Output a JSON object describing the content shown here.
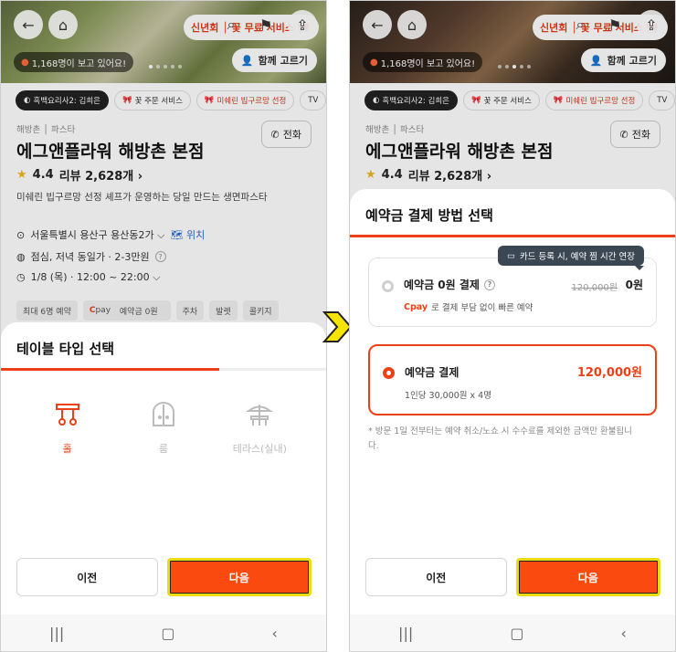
{
  "screen1": {
    "hero": {
      "promo": "신년회 │ 꽃 무료 서비스 🎀",
      "views": "1,168명이 보고 있어요!",
      "together": "함께 고르기"
    },
    "tags": [
      "흑백요리사2: 김희은",
      "꽃 주문 서비스",
      "미쉐린 빕구르망 선정",
      "TV"
    ],
    "category": "해방촌 │ 파스타",
    "call": "전화",
    "name": "에그앤플라워 해방촌 본점",
    "rating": "4.4",
    "reviews": "리뷰 2,628개 ›",
    "description": "미쉐린 빕구르망 선정 셰프가 운영하는 당일 만드는 생면파스타",
    "address": "서울특별시 용산구 용산동2가 ⌵",
    "map": "위치",
    "hours": "점심, 저녁 동일가 · 2-3만원",
    "date": "1/8 (목) · 12:00 ~ 22:00 ⌵",
    "amenities": [
      "최대 6명 예약",
      "예약금 0원",
      "주차",
      "발렛",
      "콜키지"
    ],
    "sheet": {
      "title": "테이블 타입 선택",
      "progress": 0.67,
      "types": [
        {
          "label": "홀",
          "state": "selected"
        },
        {
          "label": "룸",
          "state": "disabled"
        },
        {
          "label": "테라스(실내)",
          "state": "disabled"
        }
      ]
    },
    "buttons": {
      "prev": "이전",
      "next": "다음"
    }
  },
  "screen2": {
    "hero": {
      "promo": "신년회 │ 꽃 무료 서비스 🎀",
      "views": "1,168명이 보고 있어요!",
      "together": "함께 고르기"
    },
    "tags": [
      "흑백요리사2: 김희은",
      "꽃 주문 서비스",
      "미쉐린 빕구르망 선정",
      "TV"
    ],
    "category": "해방촌 │ 파스타",
    "call": "전화",
    "name": "에그앤플라워 해방촌 본점",
    "rating": "4.4",
    "reviews": "리뷰 2,628개 ›",
    "sheet": {
      "title": "예약금 결제 방법 선택",
      "progress": 1.0,
      "tooltip": "카드 등록 시, 예약 찜 시간 연장",
      "option0": {
        "title": "예약금 0원 결제",
        "original": "120,000원",
        "amount": "0원",
        "pay": "pay",
        "sub": "로 결제 부담 없이 빠른 예약"
      },
      "option1": {
        "title": "예약금 결제",
        "amount": "120,000원",
        "sub": "1인당 30,000원 x 4명"
      },
      "note": "* 방문 1일 전부터는 예약 취소/노쇼 시 수수료를 제외한 금액만 환불됩니다."
    },
    "buttons": {
      "prev": "이전",
      "next": "다음"
    }
  },
  "colors": {
    "accent": "#ee4016",
    "highlight": "#e8dc16",
    "star": "#f3b71c"
  }
}
